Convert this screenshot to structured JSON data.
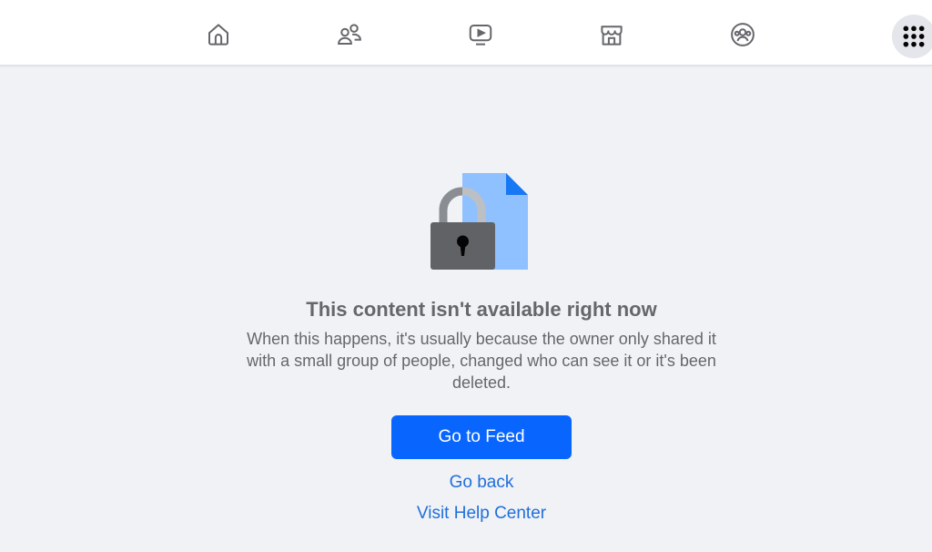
{
  "nav": {
    "items": [
      {
        "icon": "home-icon"
      },
      {
        "icon": "friends-icon"
      },
      {
        "icon": "video-icon"
      },
      {
        "icon": "marketplace-icon"
      },
      {
        "icon": "groups-icon"
      }
    ],
    "menu_icon": "menu-grid-icon"
  },
  "main": {
    "title": "This content isn't available right now",
    "description": "When this happens, it's usually because the owner only shared it with a small group of people, changed who can see it or it's been deleted.",
    "primary_button": "Go to Feed",
    "back_link": "Go back",
    "help_link": "Visit Help Center"
  },
  "colors": {
    "accent": "#0866ff",
    "link": "#216fdb",
    "text_secondary": "#65676b",
    "background": "#f0f2f5"
  }
}
